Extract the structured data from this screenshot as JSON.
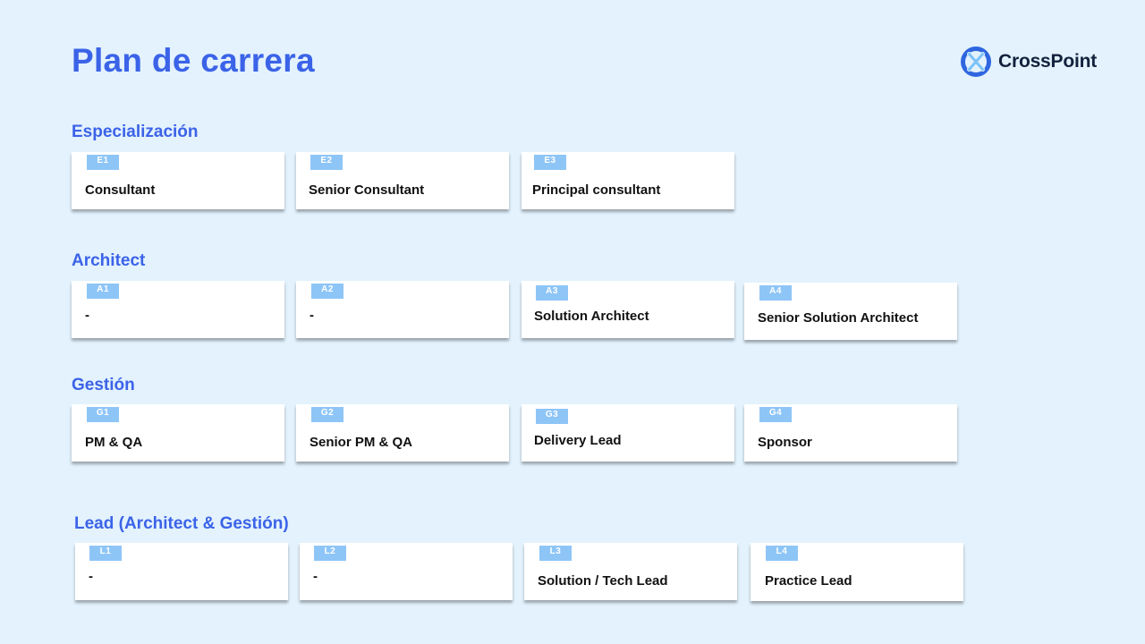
{
  "slide": {
    "title": "Plan de carrera",
    "brand": {
      "name": "CrossPoint",
      "logo_icon": "crosspoint-logo-icon",
      "logo_color": "#2f66e0",
      "logo_accent": "#7cc2f7"
    }
  },
  "colors": {
    "background": "#e3f2fd",
    "heading": "#3b63e8",
    "badge": "#8ec5f7",
    "card": "#ffffff",
    "text": "#111111"
  },
  "sections": [
    {
      "title": "Especialización",
      "cards": [
        {
          "code": "E1",
          "label": "Consultant"
        },
        {
          "code": "E2",
          "label": "Senior Consultant"
        },
        {
          "code": "E3",
          "label": "Principal consultant"
        }
      ]
    },
    {
      "title": "Architect",
      "cards": [
        {
          "code": "A1",
          "label": "-"
        },
        {
          "code": "A2",
          "label": "-"
        },
        {
          "code": "A3",
          "label": "Solution Architect"
        },
        {
          "code": "A4",
          "label": "Senior Solution Architect"
        }
      ]
    },
    {
      "title": "Gestión",
      "cards": [
        {
          "code": "G1",
          "label": "PM & QA"
        },
        {
          "code": "G2",
          "label": "Senior PM & QA"
        },
        {
          "code": "G3",
          "label": "Delivery Lead"
        },
        {
          "code": "G4",
          "label": "Sponsor"
        }
      ]
    },
    {
      "title": "Lead (Architect & Gestión)",
      "cards": [
        {
          "code": "L1",
          "label": "-"
        },
        {
          "code": "L2",
          "label": "-"
        },
        {
          "code": "L3",
          "label": "Solution / Tech Lead"
        },
        {
          "code": "L4",
          "label": "Practice Lead"
        }
      ]
    }
  ]
}
